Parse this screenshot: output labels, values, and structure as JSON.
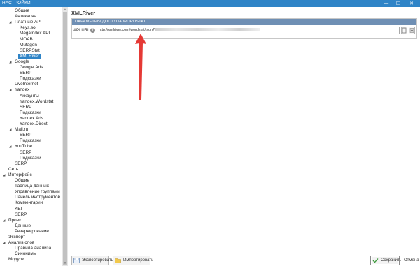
{
  "window": {
    "title": "НАСТРОЙКИ",
    "minimize": "—",
    "maximize": "☐",
    "close": "✕"
  },
  "tree": [
    {
      "label": "Общие",
      "level": 1,
      "expander": false
    },
    {
      "label": "Антикапча",
      "level": 1,
      "expander": false
    },
    {
      "label": "Платные API",
      "level": 1,
      "expander": true
    },
    {
      "label": "Keys.so",
      "level": 2,
      "expander": false
    },
    {
      "label": "MegaIndex API",
      "level": 2,
      "expander": false
    },
    {
      "label": "MOAB",
      "level": 2,
      "expander": false
    },
    {
      "label": "Mutagen",
      "level": 2,
      "expander": false
    },
    {
      "label": "SERPStat",
      "level": 2,
      "expander": false
    },
    {
      "label": "XMLRiver",
      "level": 2,
      "expander": false,
      "selected": true
    },
    {
      "label": "Google",
      "level": 1,
      "expander": true
    },
    {
      "label": "Google.Ads",
      "level": 2,
      "expander": false
    },
    {
      "label": "SERP",
      "level": 2,
      "expander": false
    },
    {
      "label": "Подсказки",
      "level": 2,
      "expander": false
    },
    {
      "label": "LiveInternet",
      "level": 1,
      "expander": false
    },
    {
      "label": "Yandex",
      "level": 1,
      "expander": true
    },
    {
      "label": "Аккаунты",
      "level": 2,
      "expander": false
    },
    {
      "label": "Yandex.Wordstat",
      "level": 2,
      "expander": false
    },
    {
      "label": "SERP",
      "level": 2,
      "expander": false
    },
    {
      "label": "Подсказки",
      "level": 2,
      "expander": false
    },
    {
      "label": "Yandex.Ads",
      "level": 2,
      "expander": false
    },
    {
      "label": "Yandex.Direct",
      "level": 2,
      "expander": false
    },
    {
      "label": "Mail.ru",
      "level": 1,
      "expander": true
    },
    {
      "label": "SERP",
      "level": 2,
      "expander": false
    },
    {
      "label": "Подсказки",
      "level": 2,
      "expander": false
    },
    {
      "label": "YouTube",
      "level": 1,
      "expander": true
    },
    {
      "label": "SERP",
      "level": 2,
      "expander": false
    },
    {
      "label": "Подсказки",
      "level": 2,
      "expander": false
    },
    {
      "label": "SERP",
      "level": 1,
      "expander": false
    },
    {
      "label": "Сеть",
      "level": 0,
      "expander": false
    },
    {
      "label": "Интерфейс",
      "level": 0,
      "expander": true
    },
    {
      "label": "Общие",
      "level": 1,
      "expander": false
    },
    {
      "label": "Таблица данных",
      "level": 1,
      "expander": false
    },
    {
      "label": "Управление группами",
      "level": 1,
      "expander": false
    },
    {
      "label": "Панель инструментов",
      "level": 1,
      "expander": false
    },
    {
      "label": "Комментарии",
      "level": 1,
      "expander": false
    },
    {
      "label": "KEI",
      "level": 1,
      "expander": false
    },
    {
      "label": "SERP",
      "level": 1,
      "expander": false
    },
    {
      "label": "Проект",
      "level": 0,
      "expander": true
    },
    {
      "label": "Данные",
      "level": 1,
      "expander": false
    },
    {
      "label": "Резервирование",
      "level": 1,
      "expander": false
    },
    {
      "label": "Экспорт",
      "level": 0,
      "expander": false
    },
    {
      "label": "Анализ слов",
      "level": 0,
      "expander": true
    },
    {
      "label": "Правила анализа",
      "level": 1,
      "expander": false
    },
    {
      "label": "Синонимы",
      "level": 1,
      "expander": false
    },
    {
      "label": "Модули",
      "level": 0,
      "expander": false
    }
  ],
  "content": {
    "heading": "XMLRiver",
    "section_title": "ПАРАМЕТРЫ ДОСТУПА WORDSTAT",
    "api_label": "API URL:",
    "help": "?",
    "api_value": "http://xmlriver.com/wordstat/json?"
  },
  "buttons": {
    "export": "Экспортировать",
    "import": "Импортировать",
    "save": "Сохранить",
    "cancel": "Отмена"
  },
  "icons": {
    "expander": "tree-expander-icon",
    "help": "help-icon",
    "copy": "clipboard-icon",
    "paste": "paste-icon",
    "export": "export-icon",
    "import": "folder-icon",
    "save": "checkmark-icon"
  },
  "colors": {
    "titlebar": "#2f84c7",
    "selection": "#2f84c7",
    "panel_header": "#6f8fb4",
    "annotation_arrow": "#e53935"
  }
}
